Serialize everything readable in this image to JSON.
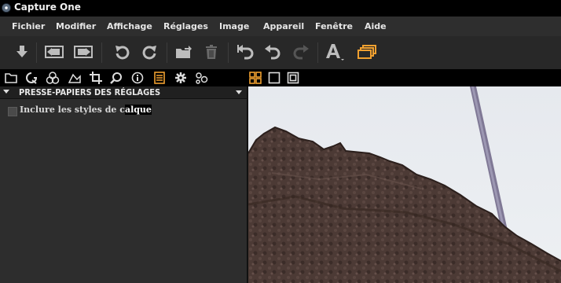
{
  "window": {
    "title": "Capture One"
  },
  "menu": [
    "Fichier",
    "Modifier",
    "Affichage",
    "Réglages",
    "Image",
    "Appareil",
    "Fenêtre",
    "Aide"
  ],
  "toolbar": {
    "buttons": [
      "import-icon",
      "previous-image-icon",
      "next-image-icon",
      "rotate-left-icon",
      "rotate-right-icon",
      "move-to-folder-icon",
      "trash-icon",
      "undo-all-icon",
      "undo-icon",
      "redo-icon",
      "text-overlay-icon",
      "variants-icon"
    ]
  },
  "tools": {
    "tabs": [
      "library-icon",
      "quick-icon",
      "color-icon",
      "exposure-icon",
      "crop-icon",
      "details-icon",
      "metadata-icon",
      "adjustments-icon",
      "output-icon",
      "batch-icon"
    ],
    "active_tab": "adjustments-icon"
  },
  "viewer": {
    "modes": [
      "browser-grid-icon",
      "single-view-icon",
      "fit-view-icon"
    ],
    "active_mode": "browser-grid-icon"
  },
  "panel": {
    "title": "PRESSE-PAPIERS DES RÉGLAGES",
    "checkbox_label_part1": "Inclure les styles de c",
    "checkbox_label_part2": "alque",
    "checkbox_checked": false
  },
  "colors": {
    "accent": "#f0a030",
    "background": "#1a1a1a"
  }
}
